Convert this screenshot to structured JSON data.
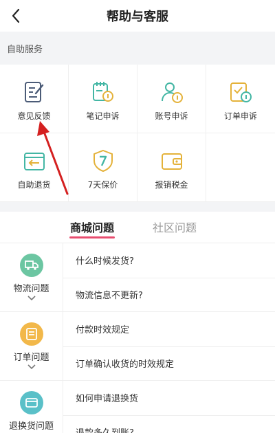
{
  "header": {
    "title": "帮助与客服"
  },
  "self_service": {
    "label": "自助服务",
    "items": [
      {
        "label": "意见反馈",
        "icon": "feedback-icon",
        "color": "#4b5b77"
      },
      {
        "label": "笔记申诉",
        "icon": "note-appeal-icon",
        "color": "#43b6a4"
      },
      {
        "label": "账号申诉",
        "icon": "account-appeal-icon",
        "color": "#43b6a4"
      },
      {
        "label": "订单申诉",
        "icon": "order-appeal-icon",
        "color": "#e4b23a"
      },
      {
        "label": "自助退货",
        "icon": "return-goods-icon",
        "color": "#43b6a4"
      },
      {
        "label": "7天保价",
        "icon": "price-protection-shield-icon",
        "color": "#e4b23a"
      },
      {
        "label": "报销税金",
        "icon": "tax-wallet-icon",
        "color": "#e4b23a"
      }
    ]
  },
  "tabs": [
    {
      "label": "商城问题",
      "active": true
    },
    {
      "label": "社区问题",
      "active": false
    }
  ],
  "categories": [
    {
      "label": "物流问题",
      "icon": "truck-icon",
      "color": "#6cc6a2",
      "questions": [
        "什么时候发货?",
        "物流信息不更新?"
      ]
    },
    {
      "label": "订单问题",
      "icon": "order-list-icon",
      "color": "#f2b84a",
      "questions": [
        "付款时效规定",
        "订单确认收货的时效规定"
      ]
    },
    {
      "label": "退换货问题",
      "icon": "exchange-icon",
      "color": "#5ac0c8",
      "questions": [
        "如何申请退换货",
        "退款多久到账?"
      ]
    }
  ],
  "colors": {
    "accent": "#e84d6f",
    "bg_gray": "#f3f4f6"
  }
}
